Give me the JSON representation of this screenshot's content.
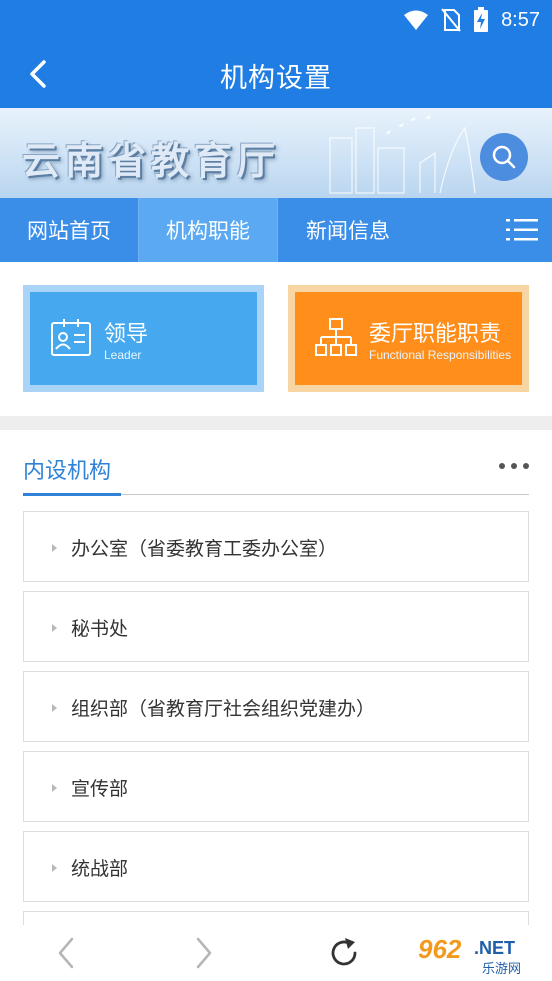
{
  "status_bar": {
    "time": "8:57"
  },
  "header": {
    "title": "机构设置",
    "back_icon": "chevron-left-icon"
  },
  "banner": {
    "title": "云南省教育厅",
    "search_icon": "search-icon"
  },
  "nav": {
    "tabs": [
      {
        "label": "网站首页",
        "active": false
      },
      {
        "label": "机构职能",
        "active": true
      },
      {
        "label": "新闻信息",
        "active": false
      }
    ],
    "menu_icon": "list-menu-icon"
  },
  "cards": [
    {
      "title": "领导",
      "subtitle": "Leader",
      "icon": "id-card-icon",
      "color": "#46a9f0"
    },
    {
      "title": "委厅职能职责",
      "subtitle": "Functional Responsibilities",
      "icon": "org-chart-icon",
      "color": "#ff8e1a"
    }
  ],
  "section": {
    "title": "内设机构",
    "items": [
      "办公室（省委教育工委办公室）",
      "秘书处",
      "组织部（省教育厅社会组织党建办）",
      "宣传部",
      "统战部"
    ]
  },
  "bottom_bar": {
    "back_icon": "arrow-left-icon",
    "forward_icon": "arrow-right-icon",
    "refresh_icon": "refresh-icon"
  },
  "watermark": {
    "number": "962",
    "suffix": ".NET",
    "caption": "乐游网"
  },
  "colors": {
    "primary": "#1f7de3",
    "nav": "#3a8ee8",
    "accent_orange": "#ff8e1a",
    "accent_blue": "#46a9f0"
  }
}
